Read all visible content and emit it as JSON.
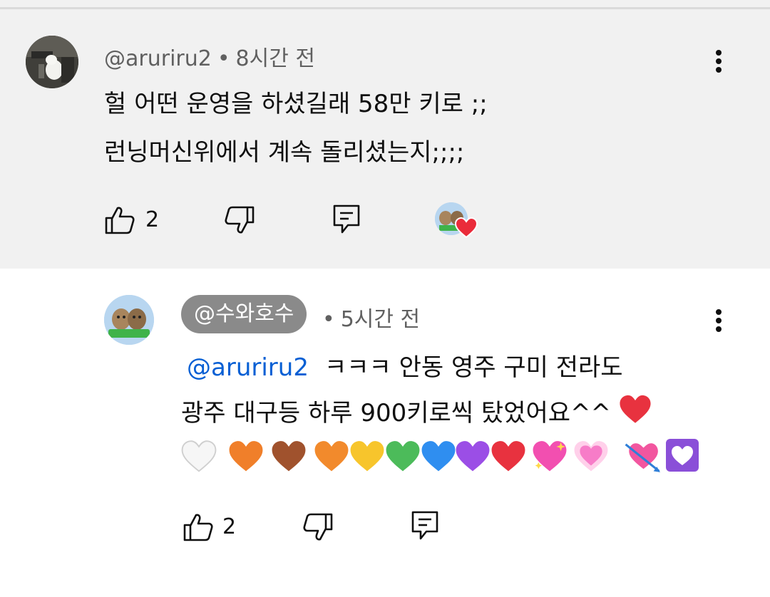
{
  "comment": {
    "author": "@aruriru2",
    "time": "8시간 전",
    "line1": "헐 어떤 운영을 하셨길래 58만 키로 ;;",
    "line2": "런닝머신위에서 계속 돌리셨는지;;;;",
    "like_count": "2"
  },
  "reply": {
    "author": "@수와호수",
    "time": "5시간 전",
    "mention": "@aruriru2",
    "line1": "ㅋㅋㅋ 안동 영주 구미 전라도",
    "line2": "광주 대구등 하루 900키로씩 탔었어요^^",
    "like_count": "2",
    "emoji_hearts": [
      "white-heart",
      "orange-heart",
      "brown-heart",
      "orange-heart",
      "yellow-heart",
      "green-heart",
      "blue-heart",
      "purple-heart",
      "red-heart",
      "sparkling-heart",
      "growing-heart",
      "heart-with-arrow",
      "heart-decoration"
    ]
  },
  "ui": {
    "separator": "•"
  },
  "colors": {
    "bg_top": "#f1f1f1",
    "mention": "#065fd4",
    "pill": "#8a8a8a",
    "secondary_text": "#606060"
  }
}
